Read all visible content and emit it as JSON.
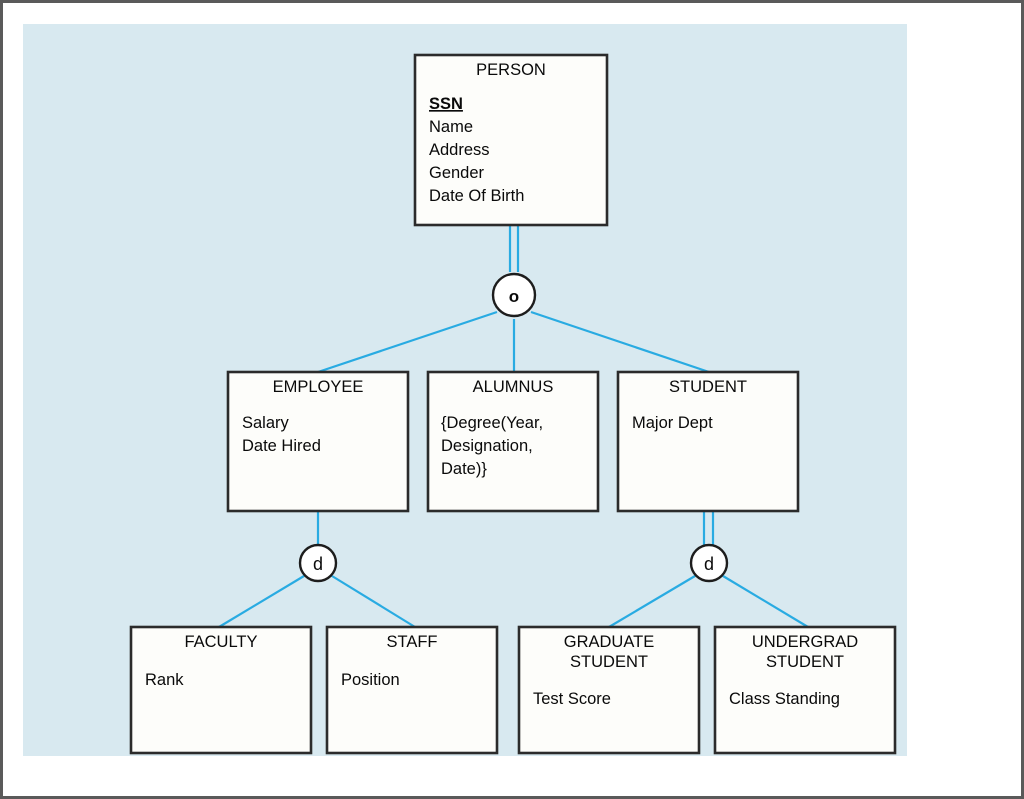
{
  "figure": {
    "kind": "eer-specialization-diagram",
    "panel_background": "#d8e9f0",
    "frame_color": "#5a5a5a",
    "line_color": "#29abe2",
    "box_border_color": "#2b2b2b",
    "box_fill": "#fdfdfa"
  },
  "entities": {
    "person": {
      "name": "PERSON",
      "attributes": [
        {
          "label": "SSN",
          "key": true
        },
        {
          "label": "Name",
          "key": false
        },
        {
          "label": "Address",
          "key": false
        },
        {
          "label": "Gender",
          "key": false
        },
        {
          "label": "Date Of Birth",
          "key": false
        }
      ]
    },
    "employee": {
      "name": "EMPLOYEE",
      "attributes": [
        {
          "label": "Salary",
          "key": false
        },
        {
          "label": "Date Hired",
          "key": false
        }
      ]
    },
    "alumnus": {
      "name": "ALUMNUS",
      "attributes": [
        {
          "label": "{Degree(Year,",
          "key": false
        },
        {
          "label": "Designation,",
          "key": false
        },
        {
          "label": "Date)}",
          "key": false
        }
      ]
    },
    "student": {
      "name": "STUDENT",
      "attributes": [
        {
          "label": "Major Dept",
          "key": false
        }
      ]
    },
    "faculty": {
      "name": "FACULTY",
      "attributes": [
        {
          "label": "Rank",
          "key": false
        }
      ]
    },
    "staff": {
      "name": "STAFF",
      "attributes": [
        {
          "label": "Position",
          "key": false
        }
      ]
    },
    "graduate_student": {
      "name_line1": "GRADUATE",
      "name_line2": "STUDENT",
      "attributes": [
        {
          "label": "Test Score",
          "key": false
        }
      ]
    },
    "undergrad_student": {
      "name_line1": "UNDERGRAD",
      "name_line2": "STUDENT",
      "attributes": [
        {
          "label": "Class Standing",
          "key": false
        }
      ]
    }
  },
  "specialization_circles": {
    "person_overlap": {
      "symbol": "o",
      "meaning": "overlapping",
      "participation": "total"
    },
    "employee_disjoint": {
      "symbol": "d",
      "meaning": "disjoint",
      "participation": "partial"
    },
    "student_disjoint": {
      "symbol": "d",
      "meaning": "disjoint",
      "participation": "total"
    }
  }
}
